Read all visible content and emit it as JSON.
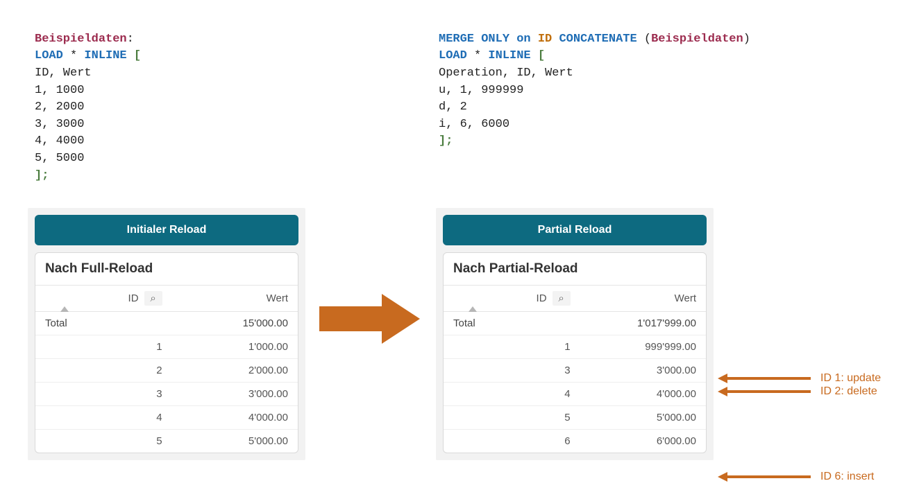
{
  "codeLeft": {
    "tableName": "Beispieldaten",
    "header": "ID, Wert",
    "rows": [
      "1, 1000",
      "2, 2000",
      "3, 3000",
      "4, 4000",
      "5, 5000"
    ]
  },
  "codeRight": {
    "mergePart1": "MERGE ONLY",
    "mergeOn": "on",
    "mergeField": "ID",
    "mergePart2": "CONCATENATE",
    "mergeTarget": "Beispieldaten",
    "header": "Operation, ID, Wert",
    "rows": [
      "u, 1, 999999",
      "d, 2",
      "i, 6, 6000"
    ]
  },
  "common": {
    "loadKw": "LOAD",
    "inlineKw": "INLINE",
    "star": "*",
    "lbrack": "[",
    "rbrack": "];",
    "colon": ":"
  },
  "buttons": {
    "initial": "Initialer Reload",
    "partial": "Partial Reload"
  },
  "tables": {
    "idHeader": "ID",
    "wertHeader": "Wert",
    "totalLabel": "Total",
    "searchGlyph": "⌕",
    "full": {
      "title": "Nach Full-Reload",
      "total": "15'000.00",
      "rows": [
        {
          "id": "1",
          "wert": "1'000.00"
        },
        {
          "id": "2",
          "wert": "2'000.00"
        },
        {
          "id": "3",
          "wert": "3'000.00"
        },
        {
          "id": "4",
          "wert": "4'000.00"
        },
        {
          "id": "5",
          "wert": "5'000.00"
        }
      ]
    },
    "partial": {
      "title": "Nach Partial-Reload",
      "total": "1'017'999.00",
      "rows": [
        {
          "id": "1",
          "wert": "999'999.00"
        },
        {
          "id": "3",
          "wert": "3'000.00"
        },
        {
          "id": "4",
          "wert": "4'000.00"
        },
        {
          "id": "5",
          "wert": "5'000.00"
        },
        {
          "id": "6",
          "wert": "6'000.00"
        }
      ]
    }
  },
  "annotations": {
    "a1": "ID 1: update",
    "a2": "ID 2: delete",
    "a3": "ID 6: insert"
  },
  "chart_data": {
    "type": "table",
    "tables": [
      {
        "name": "Nach Full-Reload",
        "columns": [
          "ID",
          "Wert"
        ],
        "rows": [
          [
            1,
            1000
          ],
          [
            2,
            2000
          ],
          [
            3,
            3000
          ],
          [
            4,
            4000
          ],
          [
            5,
            5000
          ]
        ],
        "total": 15000
      },
      {
        "name": "Nach Partial-Reload",
        "columns": [
          "ID",
          "Wert"
        ],
        "rows": [
          [
            1,
            999999
          ],
          [
            3,
            3000
          ],
          [
            4,
            4000
          ],
          [
            5,
            5000
          ],
          [
            6,
            6000
          ]
        ],
        "total": 1017999
      }
    ],
    "operations": [
      {
        "op": "update",
        "id": 1,
        "value": 999999
      },
      {
        "op": "delete",
        "id": 2
      },
      {
        "op": "insert",
        "id": 6,
        "value": 6000
      }
    ]
  }
}
